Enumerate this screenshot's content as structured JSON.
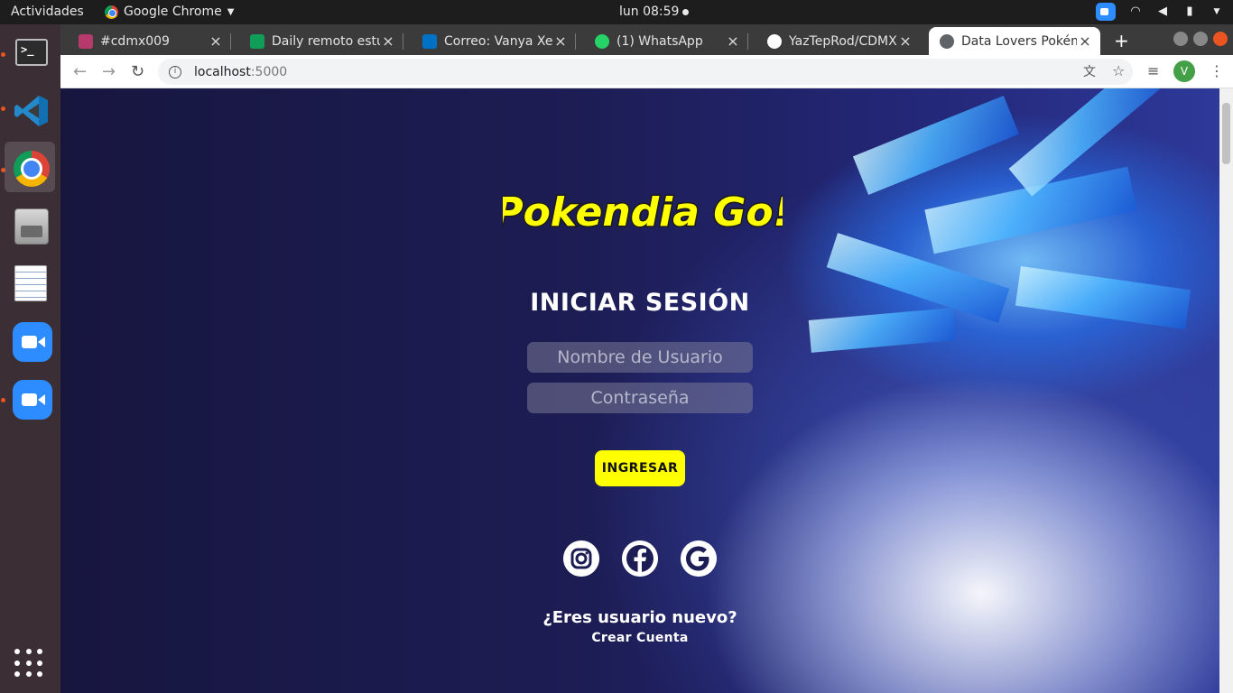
{
  "system": {
    "activities": "Actividades",
    "app_name": "Google Chrome",
    "clock": "lun 08:59"
  },
  "browser": {
    "tabs": [
      {
        "label": "#cdmx009",
        "icon": "slack-icon",
        "color": "#4a154b"
      },
      {
        "label": "Daily remoto estuc",
        "icon": "sheets-icon",
        "color": "#0f9d58"
      },
      {
        "label": "Correo: Vanya XeL",
        "icon": "outlook-icon",
        "color": "#0072c6"
      },
      {
        "label": "(1) WhatsApp",
        "icon": "whatsapp-icon",
        "color": "#25d366"
      },
      {
        "label": "YazTepRod/CDMX",
        "icon": "github-icon",
        "color": "#ffffff"
      },
      {
        "label": "Data Lovers Pokém",
        "icon": "globe-icon",
        "color": "#5f6368"
      }
    ],
    "active_tab": 5,
    "url_host": "localhost",
    "url_port": ":5000",
    "profile_initial": "V"
  },
  "login": {
    "logo_text": "Pokendia Go!",
    "title": "INICIAR SESIÓN",
    "username_placeholder": "Nombre de Usuario",
    "password_placeholder": "Contraseña",
    "submit_label": "INGRESAR",
    "new_user_question": "¿Eres usuario nuevo?",
    "create_account": "Crear Cuenta"
  },
  "colors": {
    "button": "#ffff00",
    "logo_fill": "#ffff00",
    "background": "#1d1d55"
  }
}
